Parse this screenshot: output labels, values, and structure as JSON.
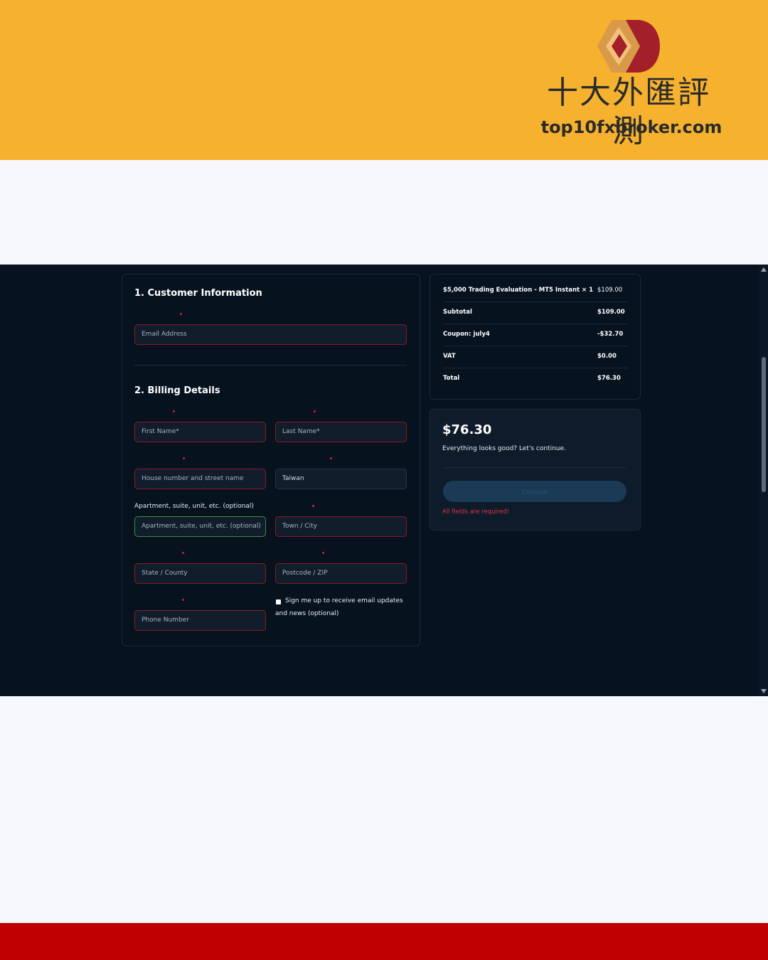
{
  "brand": {
    "name_cn": "十大外匯評測",
    "url": "top10fxbroker.com",
    "colors": {
      "banner": "#f6b22f",
      "footer": "#c00000",
      "logo_red": "#a3202a",
      "logo_gold": "#d89a48"
    }
  },
  "page": {
    "colors": {
      "background": "#061220",
      "error": "#e0343c",
      "field_error_border": "#8c1a24",
      "field_valid_border": "#3f8f3a"
    }
  },
  "customer_info": {
    "title": "1. Customer Information",
    "email_placeholder": "Email Address"
  },
  "billing": {
    "title": "2. Billing Details",
    "first_name_placeholder": "First Name*",
    "last_name_placeholder": "Last Name*",
    "street_placeholder": "House number and street name",
    "country_value": "Taiwan",
    "apartment_label": "Apartment, suite, unit, etc. (optional)",
    "apartment_placeholder": "Apartment, suite, unit, etc. (optional)",
    "city_placeholder": "Town / City",
    "state_placeholder": "State / County",
    "postcode_placeholder": "Postcode / ZIP",
    "phone_placeholder": "Phone Number",
    "signup_label": "Sign me up to receive email updates and news (optional)",
    "signup_checked": false
  },
  "order_summary": {
    "rows": [
      {
        "label": "$5,000 Trading Evaluation - MT5 Instant  × 1",
        "value": "$109.00"
      },
      {
        "label": "Subtotal",
        "value": "$109.00"
      },
      {
        "label": "Coupon: july4",
        "value": "-$32.70"
      },
      {
        "label": "VAT",
        "value": "$0.00"
      },
      {
        "label": "Total",
        "value": "$76.30"
      }
    ]
  },
  "payment": {
    "amount": "$76.30",
    "note": "Everything looks good? Let's continue.",
    "continue_label": "Continue",
    "error": "All fields are required!"
  }
}
